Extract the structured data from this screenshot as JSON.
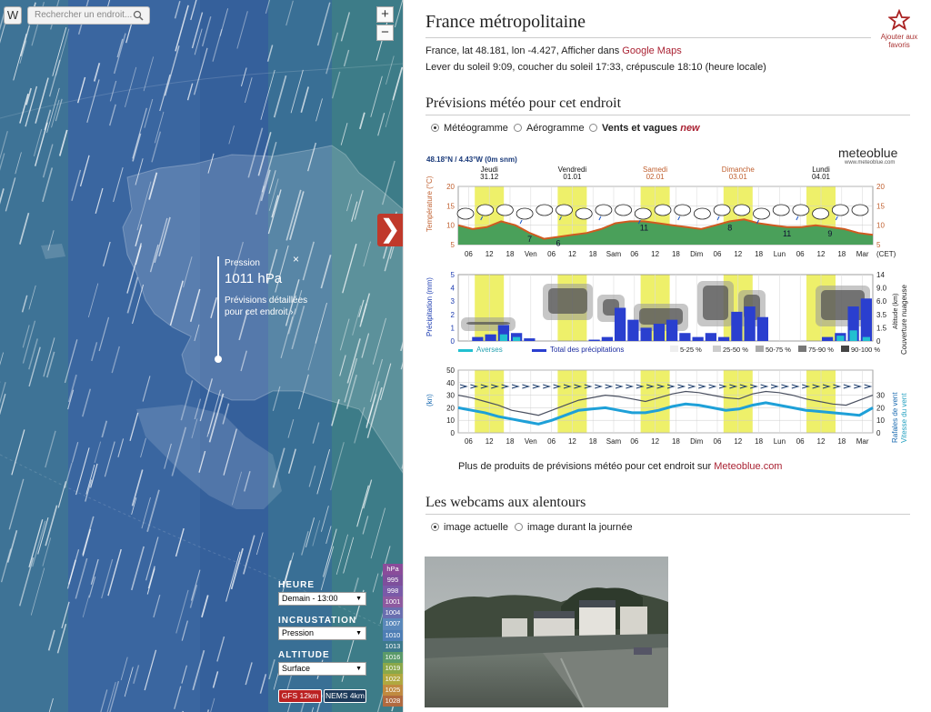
{
  "map": {
    "logo": "W",
    "search_placeholder": "Rechercher un endroit...",
    "zoom_in": "+",
    "zoom_out": "−",
    "popup": {
      "label": "Pression",
      "value": "1011 hPa",
      "link": "Prévisions détaillées pour cet endroit",
      "close": "×"
    },
    "heure_label": "HEURE",
    "heure_value": "Demain - 13:00",
    "incrustation_label": "INCRUSTATION",
    "incrustation_value": "Pression",
    "altitude_label": "ALTITUDE",
    "altitude_value": "Surface",
    "model_gfs": "GFS 12km",
    "model_nems": "NEMS 4km",
    "legend": [
      {
        "label": "hPa",
        "color": "#8a4c9a"
      },
      {
        "label": "995",
        "color": "#7e4f9c"
      },
      {
        "label": "998",
        "color": "#7a5aa8"
      },
      {
        "label": "1001",
        "color": "#8e5aa0"
      },
      {
        "label": "1004",
        "color": "#6a6fb0"
      },
      {
        "label": "1007",
        "color": "#5a88bb"
      },
      {
        "label": "1010",
        "color": "#4e7eb5"
      },
      {
        "label": "1013",
        "color": "#3d7a8c"
      },
      {
        "label": "1016",
        "color": "#5a9a6a"
      },
      {
        "label": "1019",
        "color": "#8aa84a"
      },
      {
        "label": "1022",
        "color": "#b0a840"
      },
      {
        "label": "1025",
        "color": "#c08a40"
      },
      {
        "label": "1028",
        "color": "#b06a40"
      }
    ]
  },
  "side": {
    "title": "France métropolitaine",
    "favorite": "Ajouter aux favoris",
    "coords_prefix": "France, lat 48.181, lon -4.427, Afficher dans ",
    "coords_link": "Google Maps",
    "sun": "Lever du soleil 9:09, coucher du soleil 17:33, crépuscule 18:10 (heure locale)",
    "forecast_title": "Prévisions météo pour cet endroit",
    "opt_meteogram": "Météogramme",
    "opt_aerogram": "Aérogramme",
    "opt_waves": "Vents et vagues",
    "opt_new": "new",
    "more_prefix": "Plus de produits de prévisions météo pour cet endroit sur ",
    "more_link": "Meteoblue.com",
    "webcams_title": "Les webcams aux alentours",
    "opt_current": "image actuelle",
    "opt_day": "image durant la journée"
  },
  "chart_data": [
    {
      "type": "line",
      "header": "48.18°N / 4.43°W (0m snm)",
      "brand": "meteoblue",
      "brand_sub": "www.meteoblue.com",
      "days": [
        {
          "name": "Jeudi",
          "date": "31.12",
          "weekend": false
        },
        {
          "name": "Vendredi",
          "date": "01.01",
          "weekend": false
        },
        {
          "name": "Samedi",
          "date": "02.01",
          "weekend": true
        },
        {
          "name": "Dimanche",
          "date": "03.01",
          "weekend": true
        },
        {
          "name": "Lundi",
          "date": "04.01",
          "weekend": false
        }
      ],
      "xticks": [
        "06",
        "12",
        "18",
        "Ven",
        "06",
        "12",
        "18",
        "Sam",
        "06",
        "12",
        "18",
        "Dim",
        "06",
        "12",
        "18",
        "Lun",
        "06",
        "12",
        "18",
        "Mar"
      ],
      "ylabel": "Température (°C)",
      "ylim": [
        5,
        20
      ],
      "yticks": [
        5,
        10,
        15,
        20
      ],
      "unit": "(CET)",
      "temperature": [
        10,
        9,
        9.5,
        11,
        10,
        8,
        6.5,
        7,
        7.5,
        8,
        9,
        10.5,
        11,
        11,
        10.5,
        10,
        9.5,
        9,
        10,
        11,
        11.5,
        10.5,
        10,
        9.5,
        9.5,
        10,
        9.5,
        9,
        8,
        7.5
      ],
      "labels": [
        {
          "x": 5,
          "v": "7"
        },
        {
          "x": 7,
          "v": "6"
        },
        {
          "x": 13,
          "v": "11"
        },
        {
          "x": 19,
          "v": "8"
        },
        {
          "x": 23,
          "v": "11"
        },
        {
          "x": 26,
          "v": "9"
        }
      ]
    },
    {
      "type": "bar",
      "ylabel": "Précipitation (mm)",
      "y2label": "Couverture nuageuse",
      "ylim": [
        0,
        5
      ],
      "yticks": [
        0,
        1,
        2,
        3,
        4,
        5
      ],
      "y2ticks": [
        "14",
        "9.0",
        "6.0",
        "3.5",
        "1.5",
        "0"
      ],
      "y2sub": "Altitude (km)",
      "precip_total": [
        0,
        0.3,
        0.5,
        1.2,
        0.6,
        0.2,
        0,
        0,
        0,
        0,
        0.1,
        0.3,
        2.5,
        1.6,
        1.0,
        1.3,
        1.6,
        0.6,
        0.3,
        0.6,
        0.3,
        2.2,
        2.6,
        1.8,
        0,
        0,
        0,
        0,
        0.3,
        0.6,
        2.6,
        3.2
      ],
      "showers": [
        0,
        0,
        0,
        0.5,
        0.3,
        0,
        0,
        0,
        0,
        0,
        0,
        0,
        0,
        0,
        0,
        0,
        0,
        0,
        0,
        0,
        0,
        0,
        0,
        0,
        0,
        0,
        0,
        0,
        0,
        0.4,
        0.8,
        0.3
      ],
      "legend": [
        "Averses",
        "Total des précipitations",
        "5-25 %",
        "25-50 %",
        "50-75 %",
        "75-90 %",
        "90-100 %"
      ]
    },
    {
      "type": "line",
      "ylabel": "(kn)",
      "y2label": "Rafales de vent",
      "y3label": "Vitesse du vent",
      "ylim": [
        0,
        50
      ],
      "yticks": [
        0,
        10,
        20,
        30,
        40,
        50
      ],
      "y2ticks": [
        0,
        10,
        20,
        30
      ],
      "gusts": [
        30,
        28,
        25,
        22,
        18,
        16,
        14,
        18,
        22,
        26,
        28,
        30,
        29,
        27,
        25,
        28,
        31,
        33,
        32,
        30,
        28,
        27,
        31,
        33,
        32,
        30,
        27,
        25,
        23,
        22,
        26,
        30
      ],
      "speed": [
        20,
        18,
        16,
        13,
        11,
        9,
        7,
        10,
        14,
        18,
        19,
        20,
        18,
        16,
        16,
        18,
        21,
        23,
        22,
        20,
        18,
        19,
        22,
        24,
        22,
        20,
        18,
        17,
        16,
        15,
        14,
        20
      ]
    }
  ]
}
